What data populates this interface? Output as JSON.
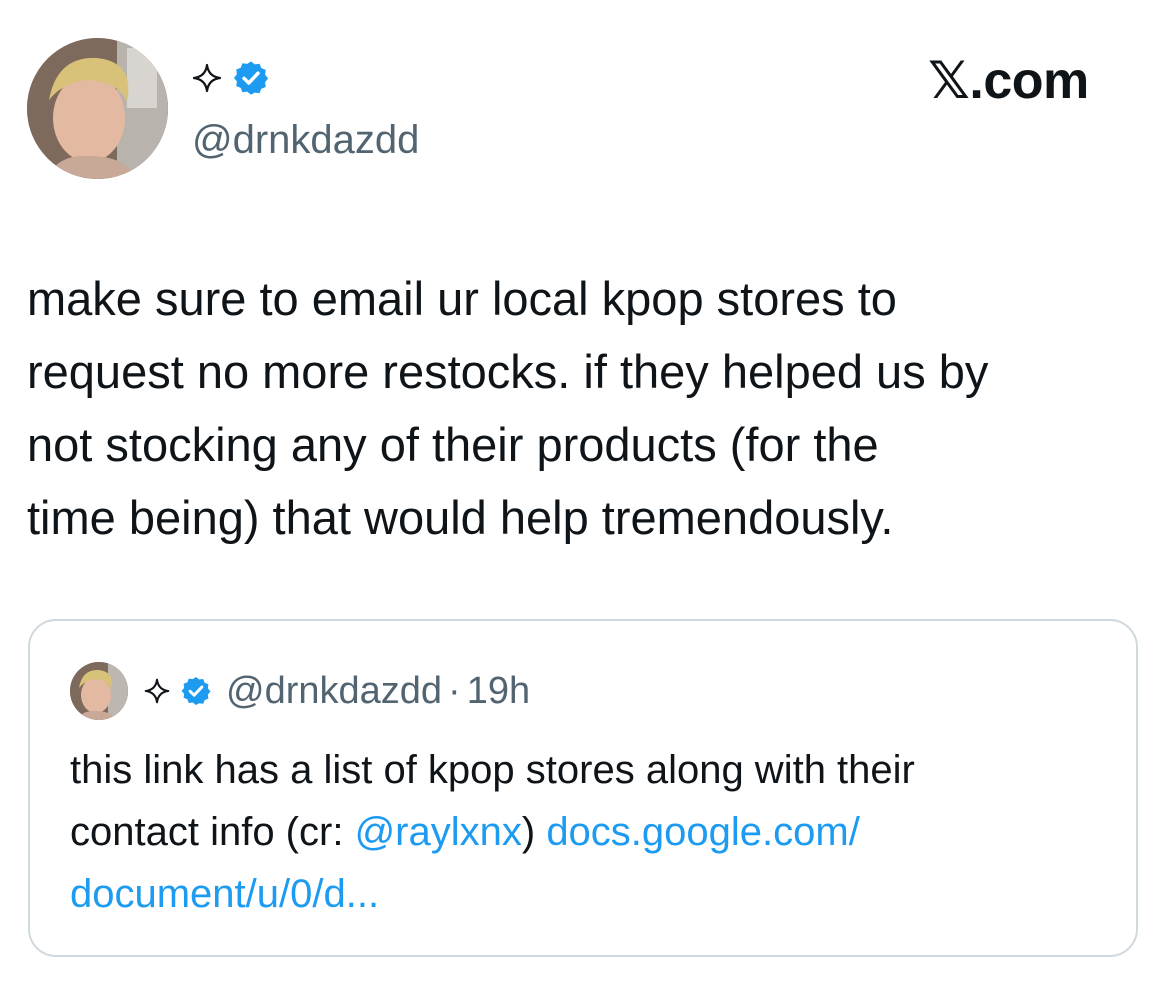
{
  "header": {
    "display_name_icons": [
      "sparkle-icon",
      "verified-badge-icon"
    ],
    "handle": "@drnkdazdd",
    "site_mark": "𝕏.com"
  },
  "tweet": {
    "text_lines": [
      "make sure to email ur local kpop stores to",
      "request no more restocks. if they helped us by",
      "not stocking any of their products (for the",
      "time being) that would help tremendously."
    ]
  },
  "quoted_tweet": {
    "handle": "@drnkdazdd",
    "separator": "·",
    "time": "19h",
    "line1": "this link has a list of kpop stores along with their",
    "line2_prefix": "contact info (cr: ",
    "mention": "@raylxnx",
    "line2_mid": ") ",
    "link_part1": "docs.google.com/",
    "link_part2": "document/u/0/d..."
  },
  "colors": {
    "text": "#0f1419",
    "secondary": "#536471",
    "link": "#1d9bf0",
    "verified": "#1d9bf0",
    "border": "#cfd9de"
  }
}
